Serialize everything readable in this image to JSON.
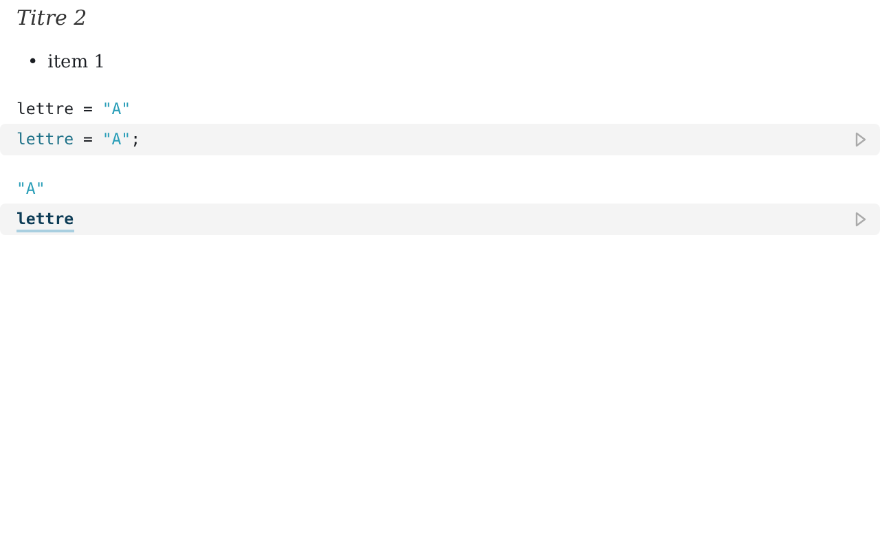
{
  "heading": "Titre 2",
  "list": [
    {
      "bullet": "•",
      "text": "item 1"
    }
  ],
  "cells": [
    {
      "output": [
        {
          "kind": "plain",
          "text": "lettre = "
        },
        {
          "kind": "string",
          "text": "\"A\""
        }
      ],
      "source": [
        {
          "kind": "variable",
          "text": "lettre"
        },
        {
          "kind": "plain",
          "text": " = "
        },
        {
          "kind": "string",
          "text": "\"A\""
        },
        {
          "kind": "plain",
          "text": ";"
        }
      ]
    },
    {
      "output": [
        {
          "kind": "string",
          "text": "\"A\""
        }
      ],
      "source": [
        {
          "kind": "reference",
          "text": "lettre"
        }
      ]
    }
  ]
}
